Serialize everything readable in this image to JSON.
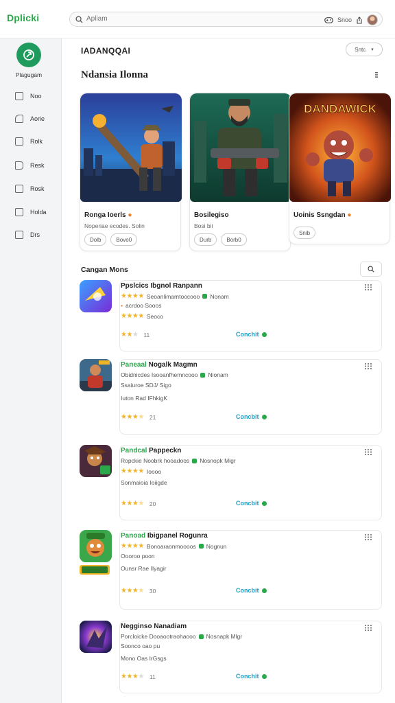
{
  "app": {
    "logo": "Dplicki"
  },
  "search": {
    "placeholder": "Apliam",
    "right_label": "Snoo"
  },
  "sidebar": {
    "profile_label": "Plagugam",
    "items": [
      {
        "label": "Noo",
        "icon": "grid-icon"
      },
      {
        "label": "Aorie",
        "icon": "shapes-icon"
      },
      {
        "label": "Rolk",
        "icon": "document-icon"
      },
      {
        "label": "Resk",
        "icon": "book-icon"
      },
      {
        "label": "Rosk",
        "icon": "image-icon"
      },
      {
        "label": "Holda",
        "icon": "edit-icon"
      },
      {
        "label": "Drs",
        "icon": "box-icon"
      }
    ]
  },
  "main": {
    "title": "IADANQQAI",
    "pill": "Sntc",
    "section_title": "Ndansia Ilonna",
    "cards": [
      {
        "title": "Ronga Ioerls",
        "subtitle": "Noperiae ecodes. Solin",
        "chips": [
          "Dolb",
          "Bovo0"
        ]
      },
      {
        "title": "Bosilegiso",
        "subtitle": "Bosi bii",
        "chips": [
          "Durb",
          "Borb0"
        ]
      },
      {
        "title": "Uoinis Ssngdan",
        "subtitle": "",
        "chips": [
          "Snib"
        ],
        "art_text": "DANDAWICK"
      }
    ],
    "list_title": "Cangan Mons",
    "list": [
      {
        "prefix": "",
        "name": "Ppslcics Ibgnol Ranpann",
        "line1": "Seoanlimamtoocooo",
        "tag1": "Nonam",
        "line2": "acrdoo Sooos",
        "line3": "Seoco",
        "rating_text": "11",
        "stars": 2.5,
        "cta": "Conchit"
      },
      {
        "prefix": "Paneaal",
        "name": "Nogalk Magmn",
        "line1": "Obidnicdes Isooanfhemncooo",
        "tag1": "Nionam",
        "line2": "Ssaiuroe SDJ/ Sigo",
        "line3": "Iuton Rad IFhkigK",
        "rating_text": "21",
        "stars": 3.5,
        "cta": "Concbit"
      },
      {
        "prefix": "Pandcal",
        "name": "Pappeckn",
        "line1": "Ropckie Noobrk hooadoos",
        "tag1": "Nosnopk Migr",
        "line2": "Ioooo",
        "line3": "Sonmaioia Ioiigde",
        "rating_text": "20",
        "stars": 3.5,
        "cta": "Concbit"
      },
      {
        "prefix": "Panoad",
        "name": "Ibigpanel Rogunra",
        "line1": "Bonoaraonmoooos",
        "tag1": "Nognun",
        "line2": "Oooroo poon",
        "line3": "Ounsr Rae IIyagir",
        "rating_text": "30",
        "stars": 3.5,
        "cta": "Concbit"
      },
      {
        "prefix": "",
        "name": "Negginso Nanadiam",
        "line1": "Porcloicke Dooaootraohaooo",
        "tag1": "Nosnapk Mlgr",
        "line2": "Soonco oao pu",
        "line3": "Mono Oas IrGsgs",
        "rating_text": "11",
        "stars": 3.0,
        "cta": "Conchit"
      }
    ]
  },
  "colors": {
    "accent_green": "#2aa84a",
    "cta_blue": "#1aa0c8",
    "star": "#f0b429"
  }
}
